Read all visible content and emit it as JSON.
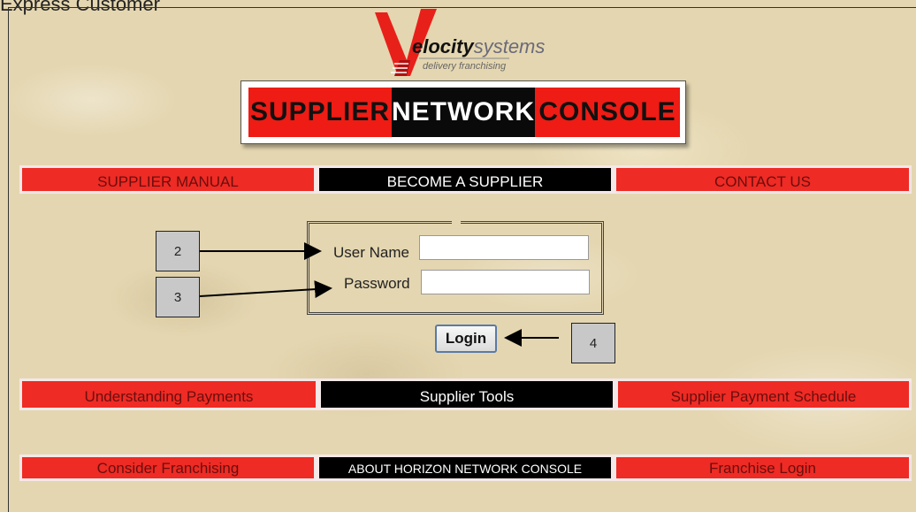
{
  "page": {
    "partial_title": "Express Customer"
  },
  "logo": {
    "brand_bold": "elocity",
    "brand_light": "systems",
    "tagline": "delivery franchising"
  },
  "banner": {
    "part1": "SUPPLIER",
    "part2": "NETWORK",
    "part3": "CONSOLE"
  },
  "nav_top": [
    "SUPPLIER MANUAL",
    "BECOME A SUPPLIER",
    "CONTACT US"
  ],
  "login": {
    "username_label": "User Name",
    "password_label": "Password",
    "username_value": "",
    "password_value": "",
    "login_button": "Login"
  },
  "nav_mid": [
    "Understanding Payments",
    "Supplier Tools",
    "Supplier Payment Schedule"
  ],
  "nav_bottom": [
    "Consider Franchising",
    "ABOUT HORIZON NETWORK CONSOLE",
    "Franchise Login"
  ],
  "callouts": [
    "2",
    "3",
    "4"
  ],
  "colors": {
    "red": "#ee2b24",
    "black": "#000000",
    "background": "#e4d6b0"
  }
}
